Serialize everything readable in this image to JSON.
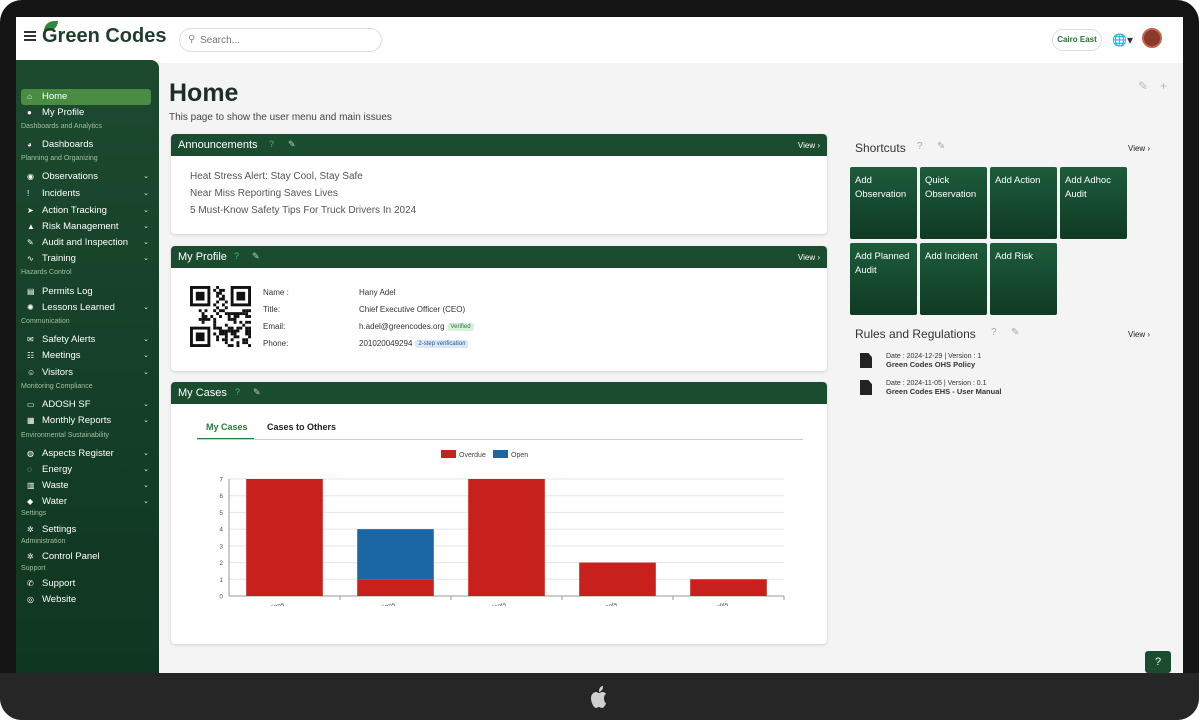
{
  "app": {
    "brand": "Green Codes",
    "search_placeholder": "Search...",
    "location": "Cairo East"
  },
  "sidebar": {
    "items": [
      {
        "label": "Home",
        "icon": "home-icon"
      },
      {
        "label": "My Profile",
        "icon": "user-icon"
      },
      {
        "section": "Dashboards and Analytics"
      },
      {
        "label": "Dashboards",
        "icon": "pie-icon"
      },
      {
        "section": "Planning and Organizing"
      },
      {
        "label": "Observations",
        "icon": "eye-icon",
        "chev": true
      },
      {
        "label": "Incidents",
        "icon": "alert-icon",
        "chev": true
      },
      {
        "label": "Action Tracking",
        "icon": "arrow-icon",
        "chev": true
      },
      {
        "label": "Risk Management",
        "icon": "warning-icon",
        "chev": true
      },
      {
        "label": "Audit and Inspection",
        "icon": "pen-icon",
        "chev": true
      },
      {
        "label": "Training",
        "icon": "chart-icon",
        "chev": true
      },
      {
        "section": "Hazards Control"
      },
      {
        "label": "Permits Log",
        "icon": "file-icon"
      },
      {
        "label": "Lessons Learned",
        "icon": "bulb-icon",
        "chev": true
      },
      {
        "section": "Communication"
      },
      {
        "label": "Safety Alerts",
        "icon": "bell-icon",
        "chev": true
      },
      {
        "label": "Meetings",
        "icon": "group-icon",
        "chev": true
      },
      {
        "label": "Visitors",
        "icon": "visitor-icon",
        "chev": true
      },
      {
        "section": "Monitoring Compliance"
      },
      {
        "label": "ADOSH SF",
        "icon": "folder-icon",
        "chev": true
      },
      {
        "label": "Monthly Reports",
        "icon": "report-icon",
        "chev": true
      },
      {
        "section": "Environmental Sustainability"
      },
      {
        "label": "Aspects Register",
        "icon": "globe-icon",
        "chev": true
      },
      {
        "label": "Energy",
        "icon": "energy-icon",
        "chev": true
      },
      {
        "label": "Waste",
        "icon": "trash-icon",
        "chev": true
      },
      {
        "label": "Water",
        "icon": "drop-icon",
        "chev": true
      },
      {
        "section": "Settings"
      },
      {
        "label": "Settings",
        "icon": "gear-icon"
      },
      {
        "section": "Administration"
      },
      {
        "label": "Control Panel",
        "icon": "gear-icon"
      },
      {
        "section": "Support"
      },
      {
        "label": "Support",
        "icon": "support-icon"
      },
      {
        "label": "Website",
        "icon": "web-icon"
      }
    ]
  },
  "main": {
    "title": "Home",
    "subtitle": "This page to show the user menu and main issues"
  },
  "announcements": {
    "title": "Announcements",
    "view": "View",
    "items": [
      "Heat Stress Alert: Stay Cool, Stay Safe",
      "Near Miss Reporting Saves Lives",
      "5 Must-Know Safety Tips For Truck Drivers In 2024"
    ]
  },
  "profile": {
    "title": "My Profile",
    "view": "View",
    "labels": {
      "name": "Name :",
      "title": "Title:",
      "email": "Email:",
      "phone": "Phone:"
    },
    "name": "Hany Adel",
    "job": "Chief Executive Officer (CEO)",
    "email": "h.adel@greencodes.org",
    "email_badge": "Verified",
    "phone": "201020049294",
    "phone_badge": "2-step verification"
  },
  "cases": {
    "title": "My Cases",
    "tabs": [
      "My Cases",
      "Cases to Others"
    ]
  },
  "chart_data": {
    "type": "bar",
    "stacked": true,
    "categories": [
      "Actions",
      "Observations",
      "Incidents",
      "Risk Assessments",
      "Audits"
    ],
    "series": [
      {
        "name": "Overdue",
        "values": [
          7,
          1,
          7,
          2,
          1
        ],
        "color": "#c8201c"
      },
      {
        "name": "Open",
        "values": [
          0,
          3,
          0,
          0,
          0
        ],
        "color": "#1b67a6"
      }
    ],
    "ylim": [
      0,
      7
    ],
    "yticks": [
      0,
      1,
      2,
      3,
      4,
      5,
      6,
      7
    ],
    "legend": "top"
  },
  "shortcuts": {
    "title": "Shortcuts",
    "view": "View",
    "tiles": [
      "Add Observation",
      "Quick Observation",
      "Add Action",
      "Add Adhoc Audit",
      "Add Planned Audit",
      "Add Incident",
      "Add Risk"
    ]
  },
  "rules": {
    "title": "Rules and Regulations",
    "view": "View",
    "docs": [
      {
        "meta": "Date : 2024-12-29 |   Version : 1",
        "name": "Green Codes OHS Policy"
      },
      {
        "meta": "Date : 2024-11-05 |   Version : 0.1",
        "name": "Green Codes EHS - User Manual"
      }
    ]
  }
}
